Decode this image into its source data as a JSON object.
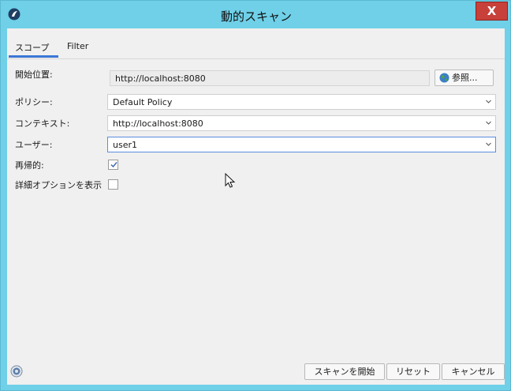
{
  "window": {
    "title": "動的スキャン",
    "close_label": "X"
  },
  "tabs": [
    {
      "label": "スコープ",
      "active": true
    },
    {
      "label": "Filter",
      "active": false
    }
  ],
  "form": {
    "start_location": {
      "label": "開始位置:",
      "value": "http://localhost:8080",
      "browse_label": "参照..."
    },
    "policy": {
      "label": "ポリシー:",
      "value": "Default Policy"
    },
    "context": {
      "label": "コンテキスト:",
      "value": "http://localhost:8080"
    },
    "user": {
      "label": "ユーザー:",
      "value": "user1"
    },
    "recursive": {
      "label": "再帰的:",
      "checked": true
    },
    "show_advanced": {
      "label": "詳細オプションを表示",
      "checked": false
    }
  },
  "buttons": {
    "start_scan": "スキャンを開始",
    "reset": "リセット",
    "cancel": "キャンセル"
  },
  "colors": {
    "frame": "#6fd0e8",
    "close": "#c8403a",
    "tab_accent": "#3b77d5",
    "client": "#f0f0f0"
  }
}
